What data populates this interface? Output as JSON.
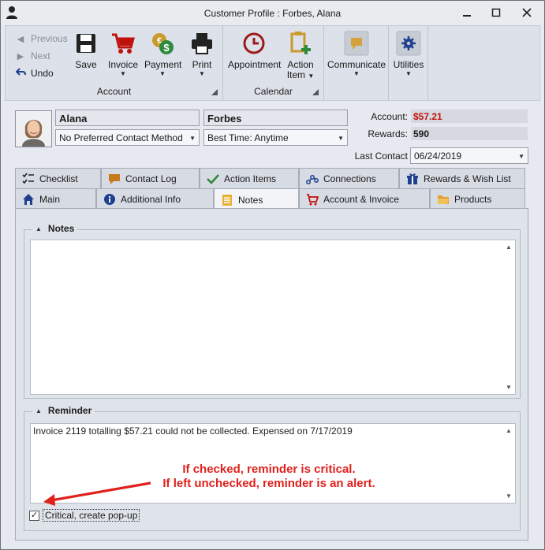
{
  "window": {
    "title": "Customer Profile : Forbes, Alana"
  },
  "ribbon": {
    "history": {
      "previous": "Previous",
      "next": "Next",
      "undo": "Undo"
    },
    "account_group": {
      "label": "Account",
      "save": "Save",
      "invoice": "Invoice",
      "payment": "Payment",
      "print": "Print"
    },
    "calendar_group": {
      "label": "Calendar",
      "appointment": "Appointment",
      "action_item_line1": "Action",
      "action_item_line2": "Item"
    },
    "communicate": "Communicate",
    "utilities": "Utilities"
  },
  "customer": {
    "first_name": "Alana",
    "last_name": "Forbes",
    "contact_method": "No Preferred Contact Method",
    "best_time": "Best Time: Anytime"
  },
  "summary": {
    "account_label": "Account:",
    "account_value": "$57.21",
    "rewards_label": "Rewards:",
    "rewards_value": "590",
    "last_contact_label": "Last Contact",
    "last_contact_value": "06/24/2019"
  },
  "tabs_row1": [
    "Checklist",
    "Contact Log",
    "Action Items",
    "Connections",
    "Rewards & Wish List"
  ],
  "tabs_row2": [
    "Main",
    "Additional Info",
    "Notes",
    "Account & Invoice",
    "Products"
  ],
  "active_tab": "Notes",
  "notes": {
    "heading": "Notes",
    "text": ""
  },
  "reminder": {
    "heading": "Reminder",
    "text": "Invoice 2119 totalling $57.21 could not be collected. Expensed on 7/17/2019",
    "critical_label": "Critical, create pop-up",
    "critical_checked": true
  },
  "annotation": {
    "line1": "If checked, reminder is critical.",
    "line2": "If left unchecked, reminder is an alert."
  },
  "colors": {
    "accent_red": "#c0120c",
    "annotation_red": "#e0211c"
  }
}
